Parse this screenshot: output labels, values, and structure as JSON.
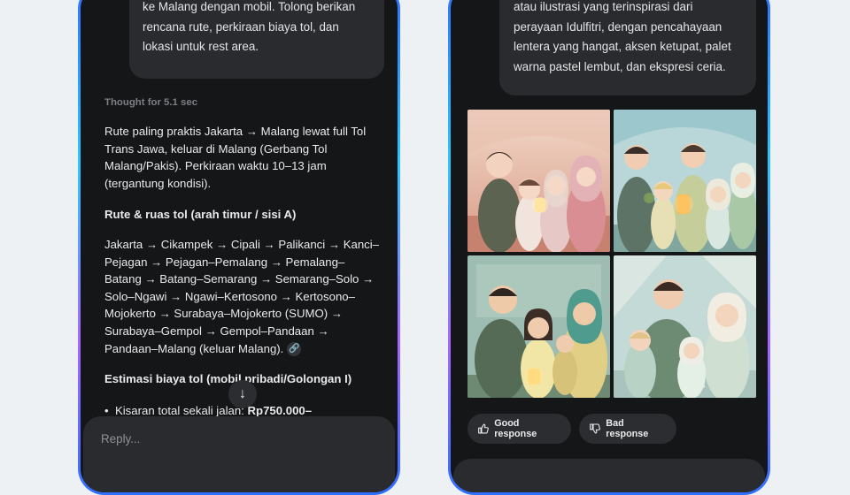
{
  "left_chat": {
    "user_message": "Saya berencana untuk mudik dari Jakarta\nke Malang dengan mobil. Tolong berikan\nrencana rute, perkiraan biaya tol, dan\nlokasi untuk rest area.",
    "thought_label": "Thought for 5.1 sec",
    "answer_intro": "Rute paling praktis Jakarta → Malang lewat full Tol\nTrans Jawa, keluar di Malang (Gerbang Tol\nMalang/Pakis). Perkiraan waktu 10–13 jam\n(tergantung kondisi).",
    "route_heading": "Rute & ruas tol (arah timur / sisi A)",
    "route_list": "Jakarta → Cikampek → Cipali → Palikanci → Kanci–\nPejagan → Pejagan–Pemalang → Pemalang–\nBatang → Batang–Semarang → Semarang–Solo →\nSolo–Ngawi → Ngawi–Kertosono → Kertosono–\nMojokerto → Surabaya–Mojokerto (SUMO) →\nSurabaya–Gempol → Gempol–Pandaan →\nPandaan–Malang (keluar Malang).",
    "link_icon": "link-icon",
    "cost_heading": "Estimasi biaya tol (mobil pribadi/Golongan I)",
    "cost_bullet_prefix": "Kisaran total sekali jalan: ",
    "cost_bullet_value": "Rp750.000–",
    "scroll_icon": "arrow-down-icon",
    "reply_placeholder": "Reply..."
  },
  "right_chat": {
    "user_message": "Buat foto keluarga dengan gaya anime\natau ilustrasi yang terinspirasi dari\nperayaan Idulfitri, dengan pencahayaan\nlentera yang hangat, aksen ketupat, palet\nwarna pastel lembut, dan ekspresi ceria.",
    "images": [
      "family-illustration-1",
      "family-illustration-2",
      "family-illustration-3",
      "family-illustration-4"
    ],
    "good_label": "Good response",
    "bad_label": "Bad response",
    "good_icon": "thumbs-up-icon",
    "bad_icon": "thumbs-down-icon"
  },
  "colors": {
    "screen_bg": "#151617",
    "bubble_bg": "#2a2b2e",
    "frame_gradient": [
      "#2f6fff",
      "#28c8ff",
      "#a866ff"
    ]
  }
}
